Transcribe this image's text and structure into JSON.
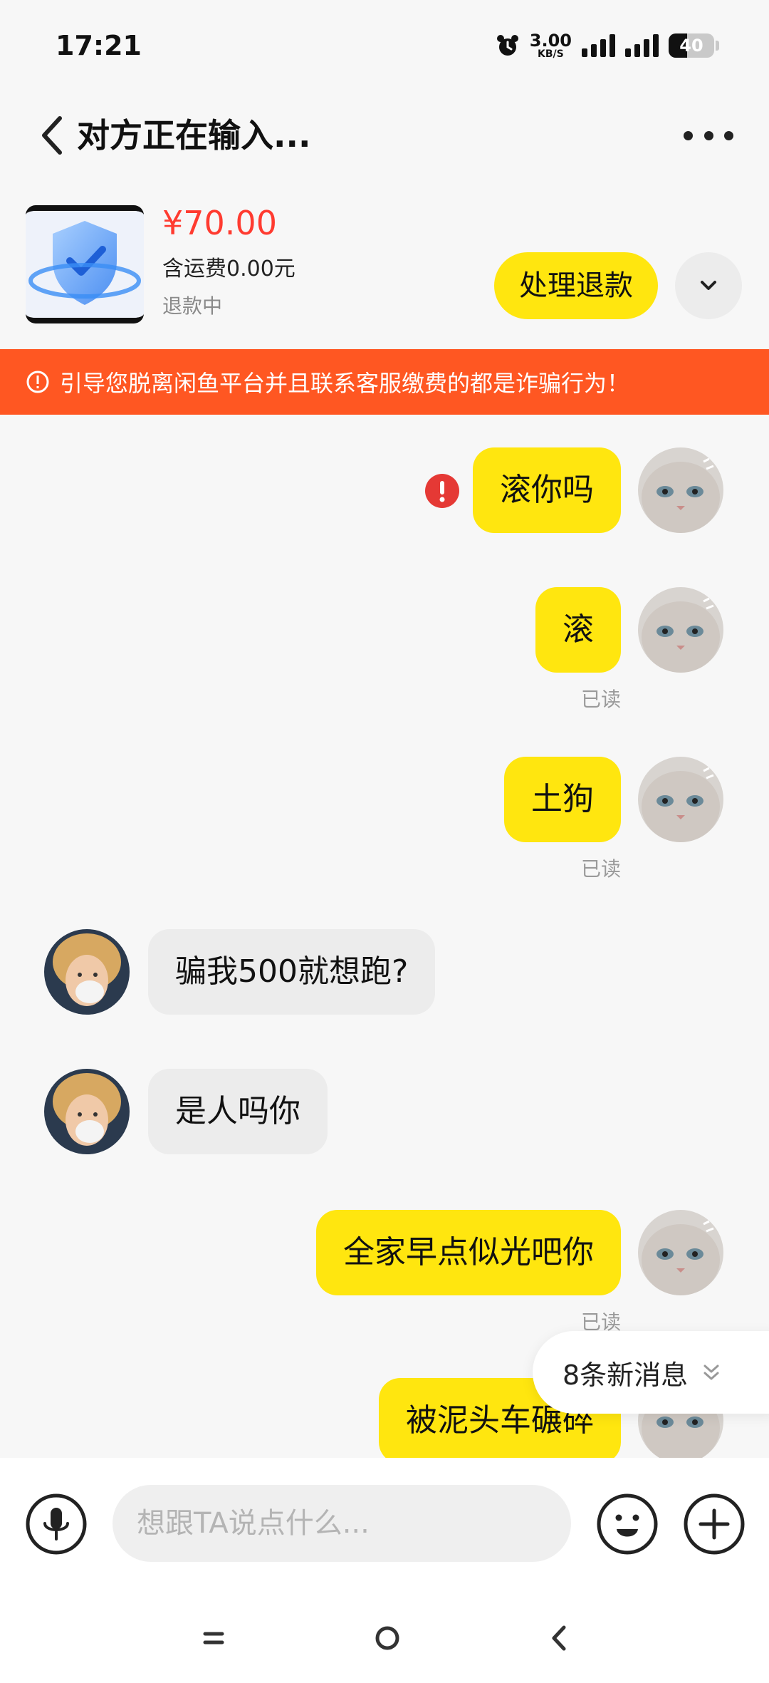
{
  "status_bar": {
    "time": "17:21",
    "net_speed_value": "3.00",
    "net_speed_unit": "KB/S",
    "battery": "40",
    "battery_level": 0.4
  },
  "header": {
    "title": "对方正在输入..."
  },
  "product": {
    "price": "¥70.00",
    "shipping": "含运费0.00元",
    "status": "退款中",
    "refund_button": "处理退款"
  },
  "warning": {
    "text": "引导您脱离闲鱼平台并且联系客服缴费的都是诈骗行为！"
  },
  "messages": [
    {
      "side": "out",
      "text": "滚你吗",
      "read": "",
      "failed": true
    },
    {
      "side": "out",
      "text": "滚",
      "read": "已读"
    },
    {
      "side": "out",
      "text": "土狗",
      "read": "已读"
    },
    {
      "side": "in",
      "text": "骗我500就想跑?",
      "read": ""
    },
    {
      "side": "in",
      "text": "是人吗你",
      "read": ""
    },
    {
      "side": "out",
      "text": "全家早点似光吧你",
      "read": "已读"
    },
    {
      "side": "out",
      "text": "被泥头车碾碎",
      "read": ""
    }
  ],
  "new_messages": "8条新消息",
  "input": {
    "placeholder": "想跟TA说点什么..."
  },
  "colors": {
    "accent_yellow": "#ffe60f",
    "warning_orange": "#ff5722",
    "price_red": "#ff3b30",
    "error_red": "#e53935"
  }
}
